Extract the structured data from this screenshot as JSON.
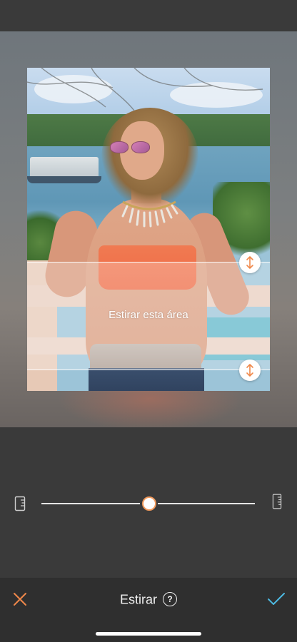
{
  "editor": {
    "stretch_area_label": "Estirar esta área",
    "tool_title": "Estirar",
    "help_symbol": "?"
  },
  "slider": {
    "value": 0.5,
    "left_icon": "ruler-short-icon",
    "right_icon": "ruler-tall-icon"
  },
  "actions": {
    "cancel_icon": "close-icon",
    "confirm_icon": "checkmark-icon"
  },
  "colors": {
    "accent_orange": "#f0884a",
    "confirm_blue": "#4cb8e0",
    "bottom_bar": "#2f2f2f",
    "background": "#3a3a3a"
  },
  "handles": {
    "top_icon": "vertical-resize-icon",
    "bottom_icon": "vertical-resize-icon"
  }
}
